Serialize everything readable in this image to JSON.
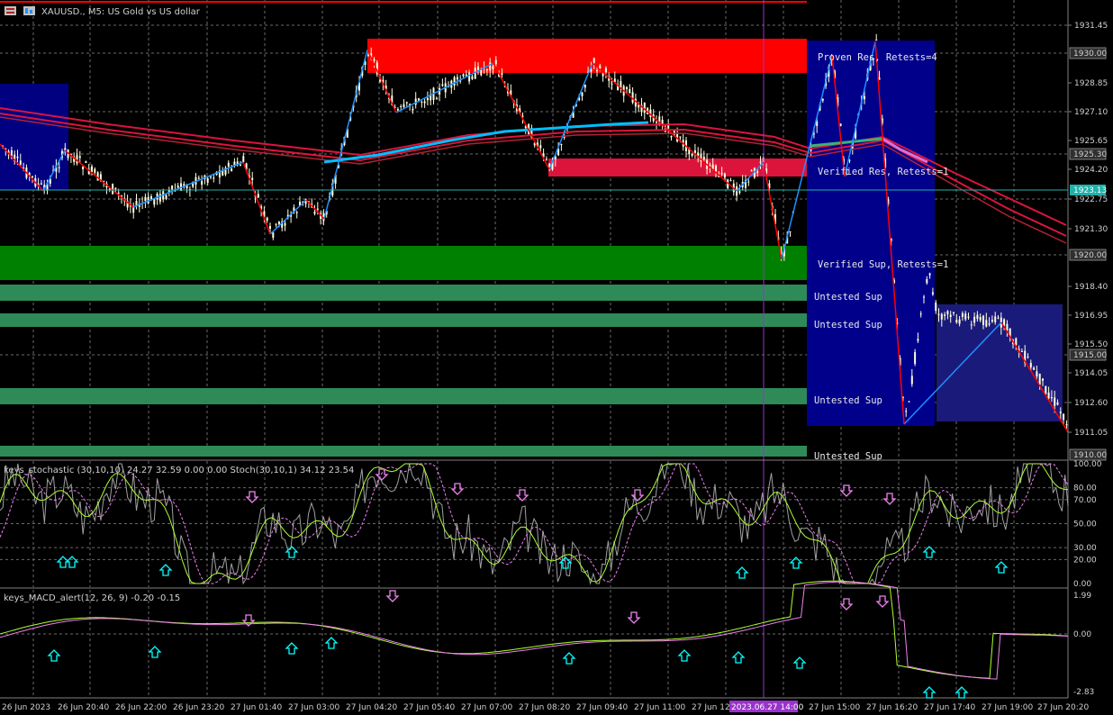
{
  "window": {
    "symbol_title": "XAUUSD., M5: US Gold vs US dollar",
    "stoch_title": "keys_stochastic (30,10,10) 24.27 32.59 0.00 0.00 Stoch(30,10,1) 34.12 23.54",
    "macd_title": "keys_MACD_alert(12, 26, 9) -0.20 -0.15"
  },
  "price_axis": {
    "ticks": [
      "1931.45",
      "1928.85",
      "1927.10",
      "1925.65",
      "1924.20",
      "1922.75",
      "1921.30",
      "1918.40",
      "1916.95",
      "1915.50",
      "1914.05",
      "1912.60",
      "1911.05"
    ],
    "boxed": [
      "1930.00",
      "1925.30",
      "1920.00",
      "1915.00",
      "1910.00"
    ],
    "current_price": "1923.13"
  },
  "stoch_axis": {
    "ticks": [
      "100.00",
      "80.00",
      "70.00",
      "50.00",
      "30.00",
      "20.00",
      "0.00"
    ]
  },
  "macd_axis": {
    "ticks": [
      "1.99",
      "0.00",
      "-2.83"
    ]
  },
  "time_axis": {
    "labels": [
      "26 Jun 2023",
      "26 Jun 20:40",
      "26 Jun 22:00",
      "26 Jun 23:20",
      "27 Jun 01:40",
      "27 Jun 03:00",
      "27 Jun 04:20",
      "27 Jun 05:40",
      "27 Jun 07:00",
      "27 Jun 08:20",
      "27 Jun 09:40",
      "27 Jun 11:00",
      "27 Jun 12",
      "27 Jun 15:00",
      "27 Jun 16:20",
      "27 Jun 17:40",
      "27 Jun 19:00",
      "27 Jun 20:20"
    ],
    "crosshair_label": "2023.06.27 14:00"
  },
  "zones": [
    {
      "label": "Proven Res, Retests=4"
    },
    {
      "label": "Verified Res, Retests=1"
    },
    {
      "label": "Verified Sup, Retests=1"
    },
    {
      "label": "Untested Sup"
    },
    {
      "label": "Untested Sup"
    },
    {
      "label": "Untested Sup"
    },
    {
      "label": "Untested Sup"
    }
  ],
  "colors": {
    "background": "#000000",
    "resistance_zone": "#ff0000",
    "resistance_zone_2": "#dc143c",
    "support_zone": "#008000",
    "untested_support": "#2e8b57",
    "box_blue": "#00008b",
    "candle": "#ffffe0",
    "ma_red": "#dc143c",
    "ma_blue": "#1e90ff",
    "zigzag_red": "#ff0000",
    "zigzag_blue": "#1e90ff",
    "arrow_up": "#00ffff",
    "arrow_down": "#ee82ee",
    "crosshair": "#9932cc"
  }
}
